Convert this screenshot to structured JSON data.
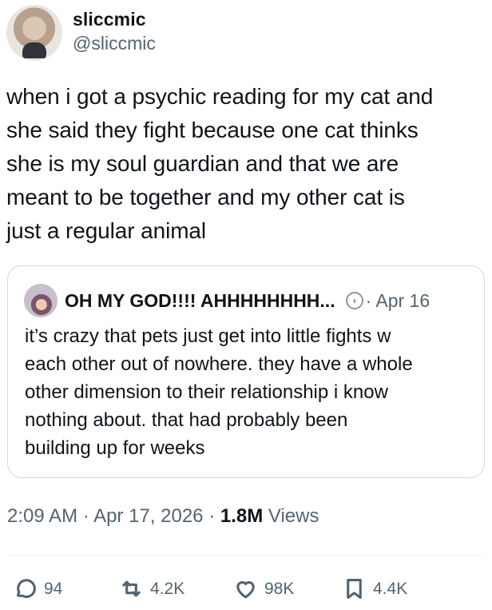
{
  "author": {
    "display_name": "sliccmic",
    "handle": "@sliccmic"
  },
  "tweet": {
    "text": "when i got a psychic reading for my cat and\nshe said they fight because one cat thinks\nshe is my soul guardian and that we are\nmeant to be together and my other cat is\njust a regular animal"
  },
  "quoted_tweet": {
    "author_name": "OH MY GOD!!!! AHHHHHHHH...",
    "date": "· Apr 16",
    "text": "it’s crazy that pets just get into little fights w\neach other out of nowhere. they have a whole\nother dimension to their relationship i know\nnothing about. that had probably been\nbuilding up for weeks"
  },
  "meta": {
    "time": "2:09 AM",
    "date": "Apr 17, 2026",
    "views_count": "1.8M",
    "views_label": "Views",
    "separator": "·"
  },
  "actions": {
    "replies": "94",
    "reposts": "4.2K",
    "likes": "98K",
    "bookmarks": "4.4K"
  },
  "icons": [
    "reply-icon",
    "repost-icon",
    "like-icon",
    "bookmark-icon",
    "verified-badge-icon"
  ]
}
